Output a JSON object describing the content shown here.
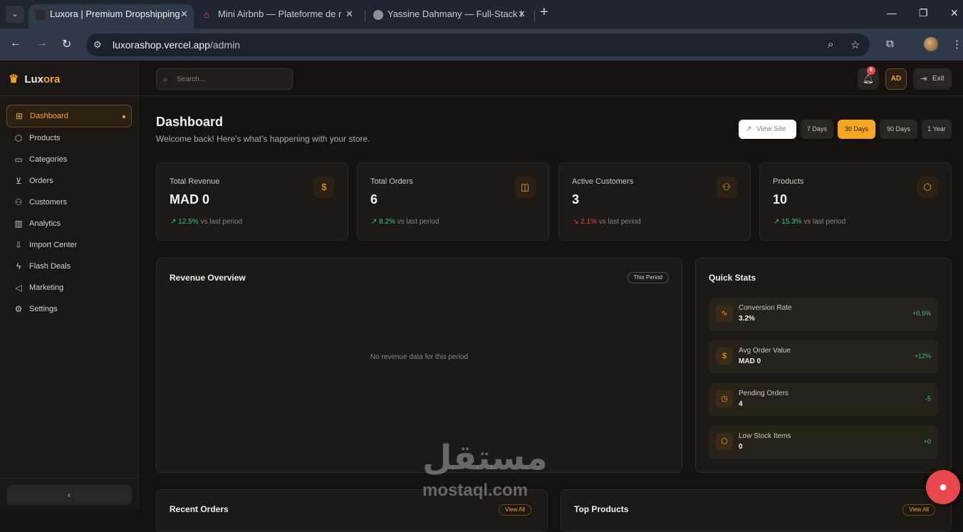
{
  "browser": {
    "tabs": [
      {
        "title": "Luxora | Premium Dropshipping",
        "active": true
      },
      {
        "title": "Mini Airbnb — Plateforme de r",
        "active": false
      },
      {
        "title": "Yassine Dahmany — Full-Stack I",
        "active": false
      }
    ],
    "close_glyph": "✕",
    "new_tab_glyph": "+",
    "url_host": "luxorashop.vercel.app",
    "url_path": "/admin"
  },
  "app": {
    "brand_prefix": "Lux",
    "brand_suffix": "ora",
    "search_placeholder": "Search...",
    "notification_count": "6",
    "avatar_initials": "AD",
    "exit_label": "Exit",
    "collapse_glyph": "‹"
  },
  "sidebar": {
    "items": [
      {
        "label": "Dashboard",
        "icon": "grid-icon",
        "active": true
      },
      {
        "label": "Products",
        "icon": "box-icon"
      },
      {
        "label": "Categories",
        "icon": "folder-icon"
      },
      {
        "label": "Orders",
        "icon": "cart-icon"
      },
      {
        "label": "Customers",
        "icon": "users-icon"
      },
      {
        "label": "Analytics",
        "icon": "chart-icon"
      },
      {
        "label": "Import Center",
        "icon": "download-icon"
      },
      {
        "label": "Flash Deals",
        "icon": "bolt-icon"
      },
      {
        "label": "Marketing",
        "icon": "megaphone-icon"
      },
      {
        "label": "Settings",
        "icon": "gear-icon"
      }
    ]
  },
  "header": {
    "title": "Dashboard",
    "subtitle": "Welcome back! Here's what's happening with your store.",
    "view_site_label": "View Site",
    "periods": [
      {
        "label": "7 Days",
        "active": false
      },
      {
        "label": "30 Days",
        "active": true
      },
      {
        "label": "90 Days",
        "active": false
      },
      {
        "label": "1 Year",
        "active": false
      }
    ]
  },
  "stats": [
    {
      "label": "Total Revenue",
      "value": "MAD 0",
      "change": "12.5%",
      "direction": "up",
      "suffix": "vs last period",
      "icon": "dollar-icon"
    },
    {
      "label": "Total Orders",
      "value": "6",
      "change": "8.2%",
      "direction": "up",
      "suffix": "vs last period",
      "icon": "bag-icon"
    },
    {
      "label": "Active Customers",
      "value": "3",
      "change": "2.1%",
      "direction": "down",
      "suffix": "vs last period",
      "icon": "users-icon"
    },
    {
      "label": "Products",
      "value": "10",
      "change": "15.3%",
      "direction": "up",
      "suffix": "vs last period",
      "icon": "cube-icon"
    }
  ],
  "revenue": {
    "title": "Revenue Overview",
    "badge": "This Period",
    "empty_text": "No revenue data for this period"
  },
  "quick_stats": {
    "title": "Quick Stats",
    "items": [
      {
        "label": "Conversion Rate",
        "value": "3.2%",
        "change": "+0.5%",
        "icon": "activity-icon"
      },
      {
        "label": "Avg Order Value",
        "value": "MAD 0",
        "change": "+12%",
        "icon": "dollar-icon"
      },
      {
        "label": "Pending Orders",
        "value": "4",
        "change": "-5",
        "icon": "clock-icon"
      },
      {
        "label": "Low Stock Items",
        "value": "0",
        "change": "+0",
        "icon": "cube-icon"
      }
    ]
  },
  "bottom_panels": {
    "recent_orders_title": "Recent Orders",
    "top_products_title": "Top Products",
    "view_all_label": "View All"
  },
  "watermark": {
    "arabic": "مستقل",
    "latin": "mostaql.com"
  },
  "colors": {
    "accent": "#f5a623",
    "background": "#151210",
    "card": "#1d1916",
    "positive": "#34c98a",
    "negative": "#e5484d"
  }
}
